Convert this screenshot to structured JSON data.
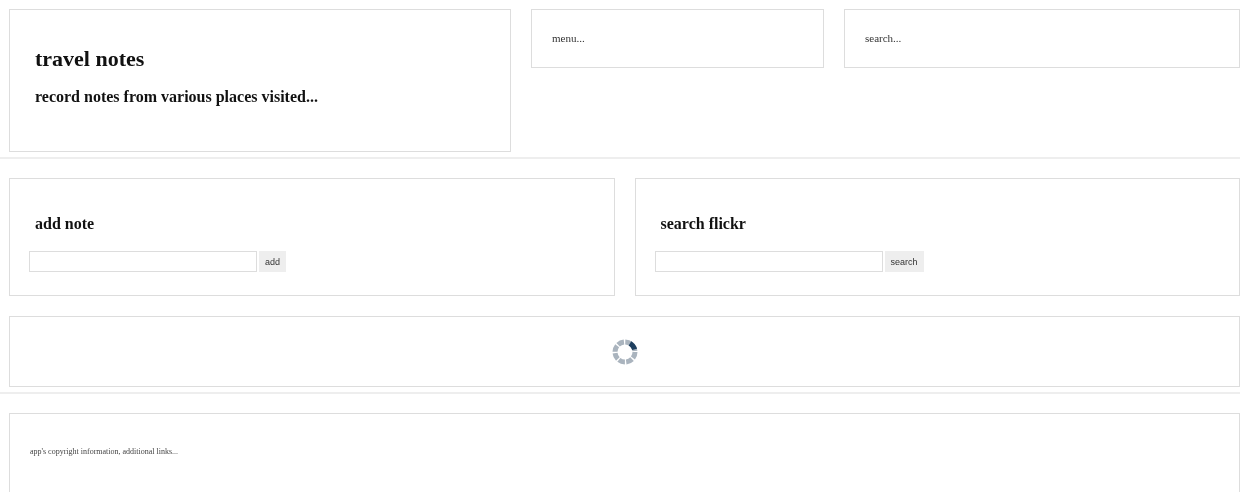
{
  "header": {
    "title": "travel notes",
    "subtitle": "record notes from various places visited..."
  },
  "menu": {
    "text": "menu..."
  },
  "search": {
    "text": "search..."
  },
  "add_note": {
    "heading": "add note",
    "button": "add"
  },
  "search_flickr": {
    "heading": "search flickr",
    "button": "search"
  },
  "footer": {
    "text": "app's copyright information, additional links..."
  }
}
